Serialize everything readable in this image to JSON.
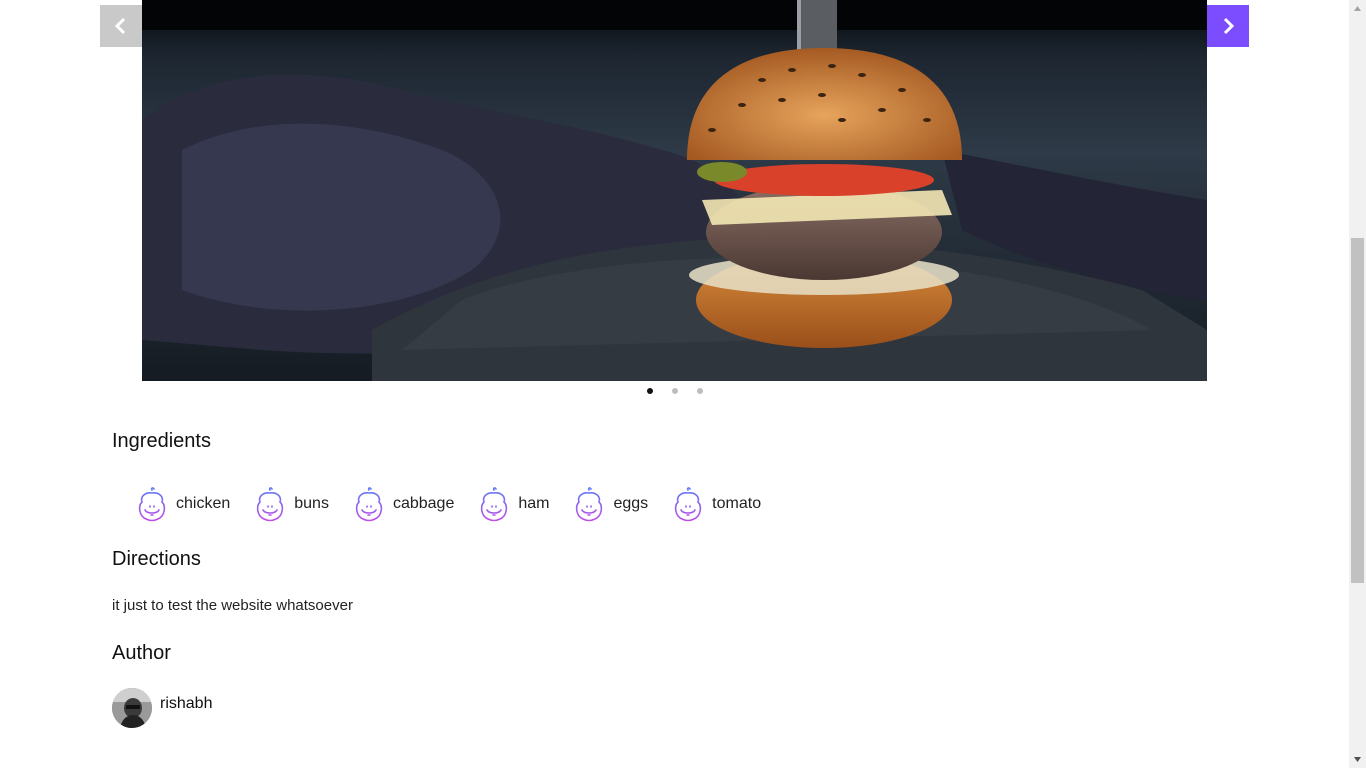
{
  "carousel": {
    "prev_icon": "chevron-left-icon",
    "next_icon": "chevron-right-icon",
    "image": "burger-photo",
    "dots": 3,
    "active_dot": 1
  },
  "sections": {
    "ingredients_title": "Ingredients",
    "directions_title": "Directions",
    "author_title": "Author"
  },
  "ingredients": [
    {
      "label": "chicken",
      "icon": "ingredient-icon"
    },
    {
      "label": "buns",
      "icon": "ingredient-icon"
    },
    {
      "label": "cabbage",
      "icon": "ingredient-icon"
    },
    {
      "label": "ham",
      "icon": "ingredient-icon"
    },
    {
      "label": "eggs",
      "icon": "ingredient-icon"
    },
    {
      "label": "tomato",
      "icon": "ingredient-icon"
    }
  ],
  "directions": {
    "text": "it just to test the website whatsoever"
  },
  "author": {
    "name": "rishabh",
    "avatar": "avatar-photo"
  },
  "colors": {
    "accent": "#7c4dff",
    "icon_stroke_top": "#5b7cf7",
    "icon_stroke_bottom": "#c04fe8"
  }
}
